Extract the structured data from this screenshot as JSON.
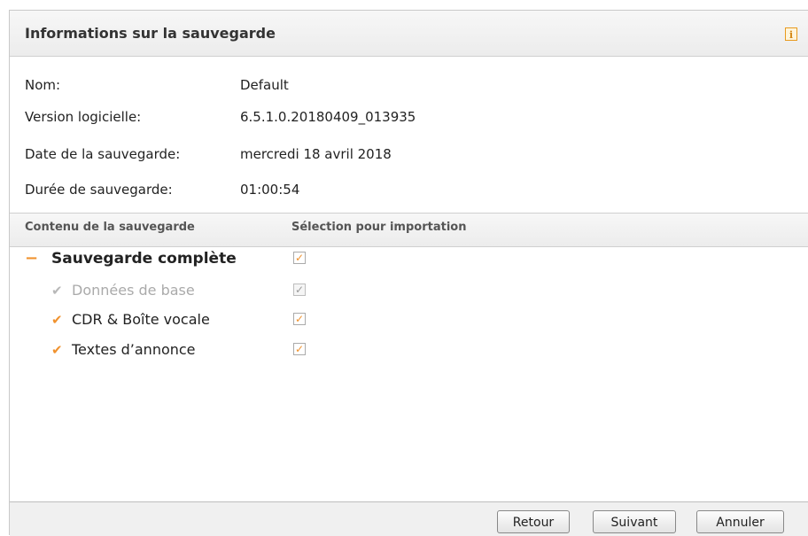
{
  "dialog": {
    "title": "Informations sur la sauvegarde",
    "info_icon": "info-icon"
  },
  "info": {
    "nom_label": "Nom:",
    "nom_value": "Default",
    "version_label": "Version logicielle:",
    "version_value": "6.5.1.0.20180409_013935",
    "date_label": "Date de la sauvegarde:",
    "date_value": "mercredi 18 avril 2018",
    "duree_label": "Durée de sauvegarde:",
    "duree_value": "01:00:54"
  },
  "table": {
    "col_content": "Contenu de la sauvegarde",
    "col_selection": "Sélection pour importation",
    "rows": [
      {
        "label": "Sauvegarde complète",
        "marker": "−",
        "checked": true,
        "enabled": true
      },
      {
        "label": "Données de base",
        "marker": "✔",
        "checked": true,
        "enabled": false
      },
      {
        "label": "CDR & Boîte vocale",
        "marker": "✔",
        "checked": true,
        "enabled": true
      },
      {
        "label": "Textes d’annonce",
        "marker": "✔",
        "checked": true,
        "enabled": true
      }
    ]
  },
  "buttons": {
    "back": "Retour",
    "next": "Suivant",
    "cancel": "Annuler"
  },
  "colors": {
    "accent": "#f0922e",
    "disabled": "#aaaaaa"
  }
}
